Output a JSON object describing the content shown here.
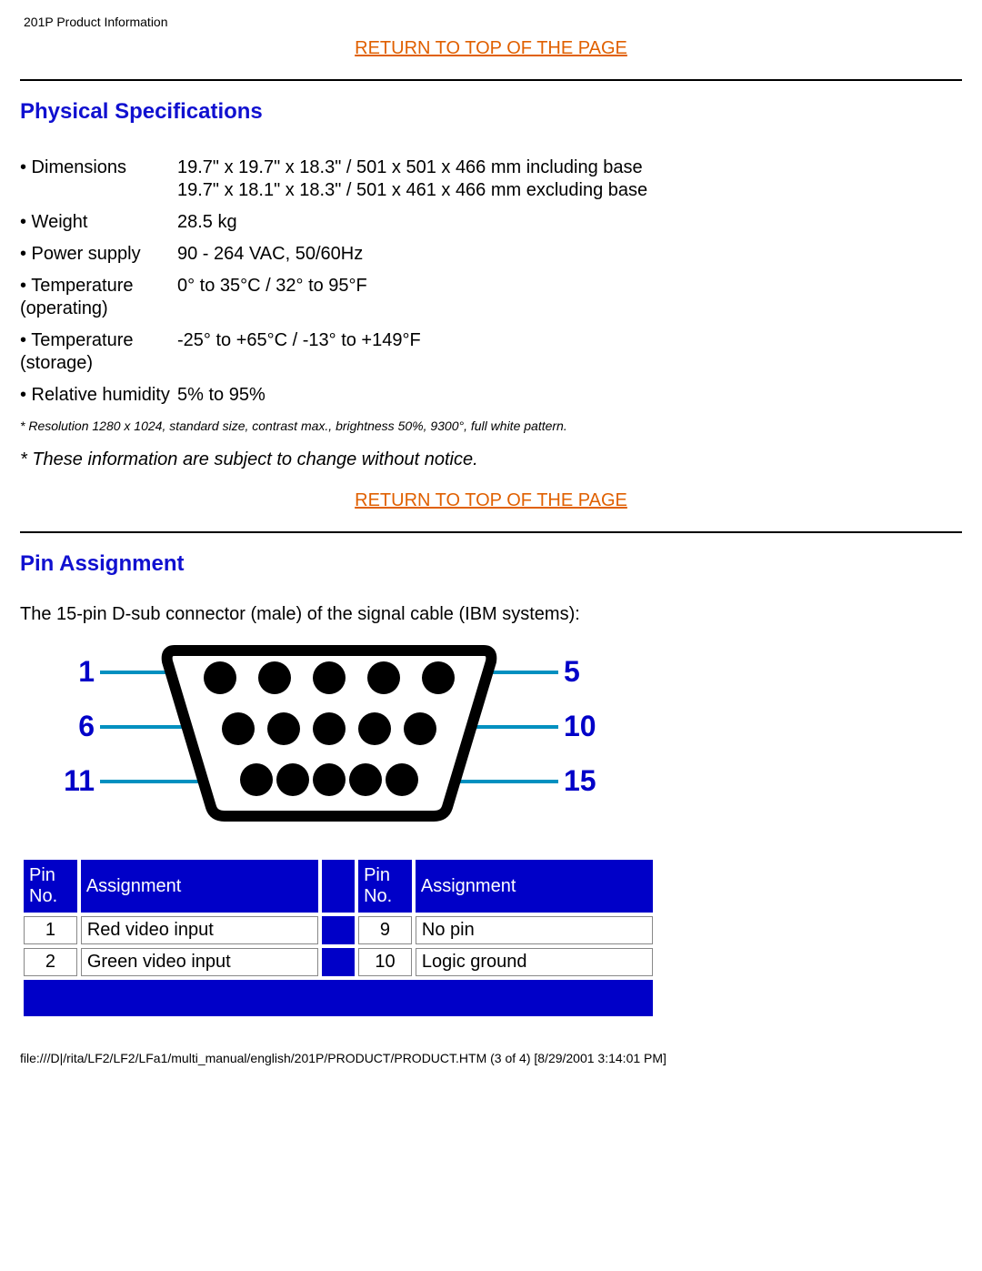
{
  "header": "201P Product Information",
  "return_link": "RETURN TO TOP OF THE PAGE",
  "section_physical": "Physical Specifications",
  "specs": {
    "dimensions_label": "• Dimensions",
    "dimensions_value": "19.7\" x 19.7\" x 18.3\" / 501 x 501 x 466 mm including base\n19.7\" x 18.1\" x 18.3\" / 501 x 461 x 466 mm excluding base",
    "weight_label": "• Weight",
    "weight_value": "28.5 kg",
    "power_label": "• Power supply",
    "power_value": "90 - 264 VAC, 50/60Hz",
    "temp_op_label": "• Temperature (operating)",
    "temp_op_value": "0° to 35°C / 32° to 95°F",
    "temp_st_label": "• Temperature (storage)",
    "temp_st_value": "-25° to +65°C / -13° to +149°F",
    "humidity_label": "• Relative humidity",
    "humidity_value": "5% to 95%"
  },
  "footnote": "* Resolution 1280 x 1024, standard size, contrast max., brightness 50%, 9300°, full white pattern.",
  "disclaimer": "* These information are subject to change without notice.",
  "section_pin": "Pin Assignment",
  "pin_desc": "The 15-pin D-sub connector (male) of the signal cable (IBM systems):",
  "diagram": {
    "n1": "1",
    "n5": "5",
    "n6": "6",
    "n10": "10",
    "n11": "11",
    "n15": "15"
  },
  "pin_table": {
    "h_pin": "Pin No.",
    "h_assign": "Assignment",
    "rows": [
      {
        "l_no": "1",
        "l_a": "Red video input",
        "r_no": "9",
        "r_a": "No pin"
      },
      {
        "l_no": "2",
        "l_a": "Green video input",
        "r_no": "10",
        "r_a": "Logic ground"
      }
    ]
  },
  "footer": "file:///D|/rita/LF2/LF2/LFa1/multi_manual/english/201P/PRODUCT/PRODUCT.HTM (3 of 4) [8/29/2001 3:14:01 PM]"
}
